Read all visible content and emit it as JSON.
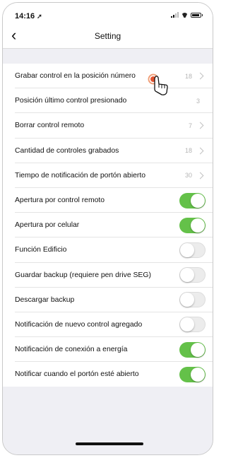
{
  "status_bar": {
    "time": "14:16"
  },
  "nav": {
    "title": "Setting"
  },
  "settings": [
    {
      "label": "Grabar control en la posición número",
      "value": "18",
      "type": "link"
    },
    {
      "label": "Posición último control presionado",
      "value": "3",
      "type": "value"
    },
    {
      "label": "Borrar control remoto",
      "value": "7",
      "type": "link"
    },
    {
      "label": "Cantidad de controles grabados",
      "value": "18",
      "type": "link"
    },
    {
      "label": "Tiempo de notificación de portón abierto",
      "value": "30",
      "type": "link"
    },
    {
      "label": "Apertura por control remoto",
      "enabled": true,
      "type": "toggle"
    },
    {
      "label": "Apertura por celular",
      "enabled": true,
      "type": "toggle"
    },
    {
      "label": "Función Edificio",
      "enabled": false,
      "type": "toggle"
    },
    {
      "label": "Guardar backup (requiere pen drive SEG)",
      "enabled": false,
      "type": "toggle"
    },
    {
      "label": "Descargar backup",
      "enabled": false,
      "type": "toggle"
    },
    {
      "label": "Notificación de nuevo control agregado",
      "enabled": false,
      "type": "toggle"
    },
    {
      "label": "Notificación de conexión a energía",
      "enabled": true,
      "type": "toggle"
    },
    {
      "label": "Notificar cuando el portón esté abierto",
      "enabled": true,
      "type": "toggle"
    }
  ],
  "colors": {
    "toggle_on": "#64c149",
    "toggle_off": "#ececec",
    "background": "#efeff4"
  },
  "icons": {
    "back": "chevron-left-icon",
    "tap_hint": "hand-pointer-icon"
  }
}
